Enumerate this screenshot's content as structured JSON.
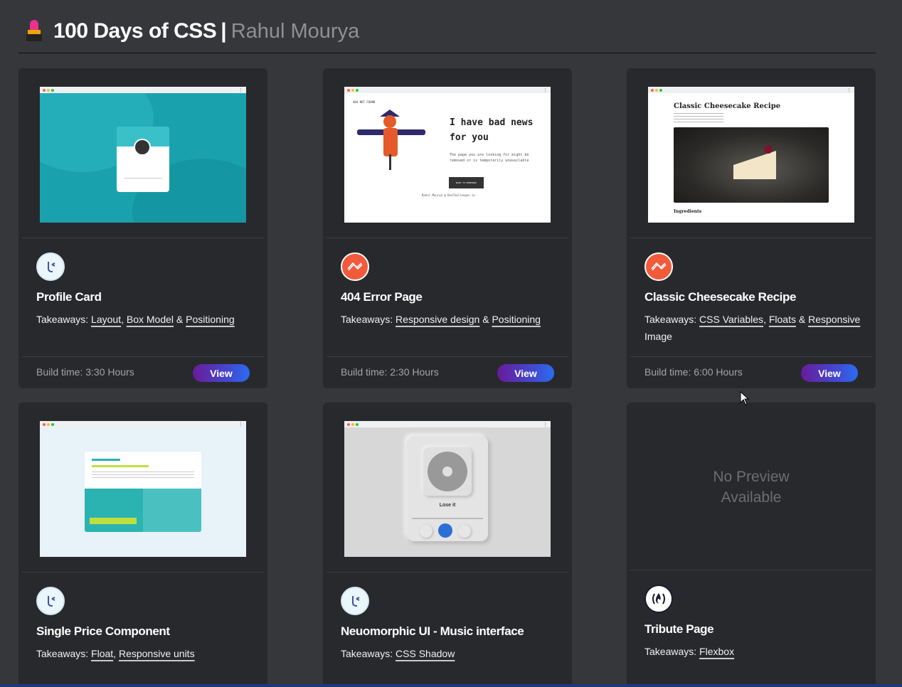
{
  "header": {
    "title": "100 Days of CSS",
    "separator": "|",
    "author": "Rahul Mourya",
    "icon": "lipstick-icon"
  },
  "cards": [
    {
      "title": "Profile Card",
      "logo": "frontend-mentor-logo-icon",
      "takeaways_label": "Takeaways:",
      "tags": [
        "Layout",
        "Box Model",
        "Positioning"
      ],
      "build_time": "Build time: 3:30 Hours",
      "view_label": "View"
    },
    {
      "title": "404 Error Page",
      "logo": "codedamn-logo-icon",
      "takeaways_label": "Takeaways:",
      "tags": [
        "Responsive design",
        "Positioning"
      ],
      "build_time": "Build time: 2:30 Hours",
      "view_label": "View",
      "preview": {
        "tag": "404 NOT FOUND",
        "heading_line1": "I have bad news",
        "heading_line2": "for you",
        "body": "The page you are looking for might be removed or is temporarily unavailable",
        "button": "BACK TO HOMEPAGE",
        "footer": "Rahul Mourya @ DevChallenges.io"
      }
    },
    {
      "title": "Classic Cheesecake Recipe",
      "logo": "codedamn-logo-icon",
      "takeaways_label": "Takeaways:",
      "tags": [
        "CSS Variables",
        "Floats",
        "Responsive"
      ],
      "tail": "Image",
      "build_time": "Build time: 6:00 Hours",
      "view_label": "View",
      "preview": {
        "heading": "Classic Cheesecake Recipe",
        "section": "Ingredients"
      }
    },
    {
      "title": "Single Price Component",
      "logo": "frontend-mentor-logo-icon",
      "takeaways_label": "Takeaways:",
      "tags": [
        "Float",
        "Responsive units"
      ]
    },
    {
      "title": "Neuomorphic UI - Music interface",
      "logo": "frontend-mentor-logo-icon",
      "takeaways_label": "Takeaways:",
      "tags": [
        "CSS Shadow"
      ],
      "preview": {
        "song": "Lose it"
      }
    },
    {
      "title": "Tribute Page",
      "logo": "freecodecamp-logo-icon",
      "takeaways_label": "Takeaways:",
      "tags": [
        "Flexbox"
      ],
      "no_preview_line1": "No Preview",
      "no_preview_line2": "Available"
    }
  ],
  "colors": {
    "background": "#36373b",
    "card": "#28292d",
    "button_gradient_start": "#6a1b9a",
    "button_gradient_end": "#2b6df0"
  }
}
